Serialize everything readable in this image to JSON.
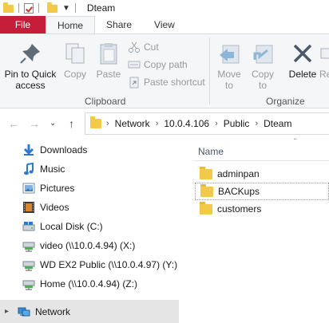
{
  "window": {
    "title": "Dteam"
  },
  "ribbon_tabs": [
    "File",
    "Home",
    "Share",
    "View"
  ],
  "clipboard": {
    "pin_label_1": "Pin to Quick",
    "pin_label_2": "access",
    "copy": "Copy",
    "paste": "Paste",
    "cut": "Cut",
    "copy_path": "Copy path",
    "paste_shortcut": "Paste shortcut",
    "group_label": "Clipboard"
  },
  "organize": {
    "move_to_1": "Move",
    "move_to_2": "to",
    "copy_to_1": "Copy",
    "copy_to_2": "to",
    "delete": "Delete",
    "rename_partial": "Re",
    "group_label": "Organize"
  },
  "address": {
    "crumbs": [
      "Network",
      "10.0.4.106",
      "Public",
      "Dteam"
    ]
  },
  "navpane": {
    "items": [
      {
        "label": "Downloads",
        "icon": "downloads-icon"
      },
      {
        "label": "Music",
        "icon": "music-icon"
      },
      {
        "label": "Pictures",
        "icon": "pictures-icon"
      },
      {
        "label": "Videos",
        "icon": "videos-icon"
      },
      {
        "label": "Local Disk (C:)",
        "icon": "local-disk-icon"
      },
      {
        "label": "video (\\\\10.0.4.94) (X:)",
        "icon": "network-drive-icon"
      },
      {
        "label": "WD EX2 Public (\\\\10.0.4.97) (Y:)",
        "icon": "network-drive-icon"
      },
      {
        "label": "Home (\\\\10.0.4.94) (Z:)",
        "icon": "network-drive-icon"
      }
    ],
    "network": "Network"
  },
  "filelist": {
    "column_name": "Name",
    "files": [
      "adminpan",
      "BACKups",
      "customers"
    ]
  },
  "colors": {
    "file_tab": "#c41e3a",
    "folder": "#f3c94a",
    "ribbon_bg": "#f5f6f7",
    "selected_bg": "#e5e5e5"
  }
}
